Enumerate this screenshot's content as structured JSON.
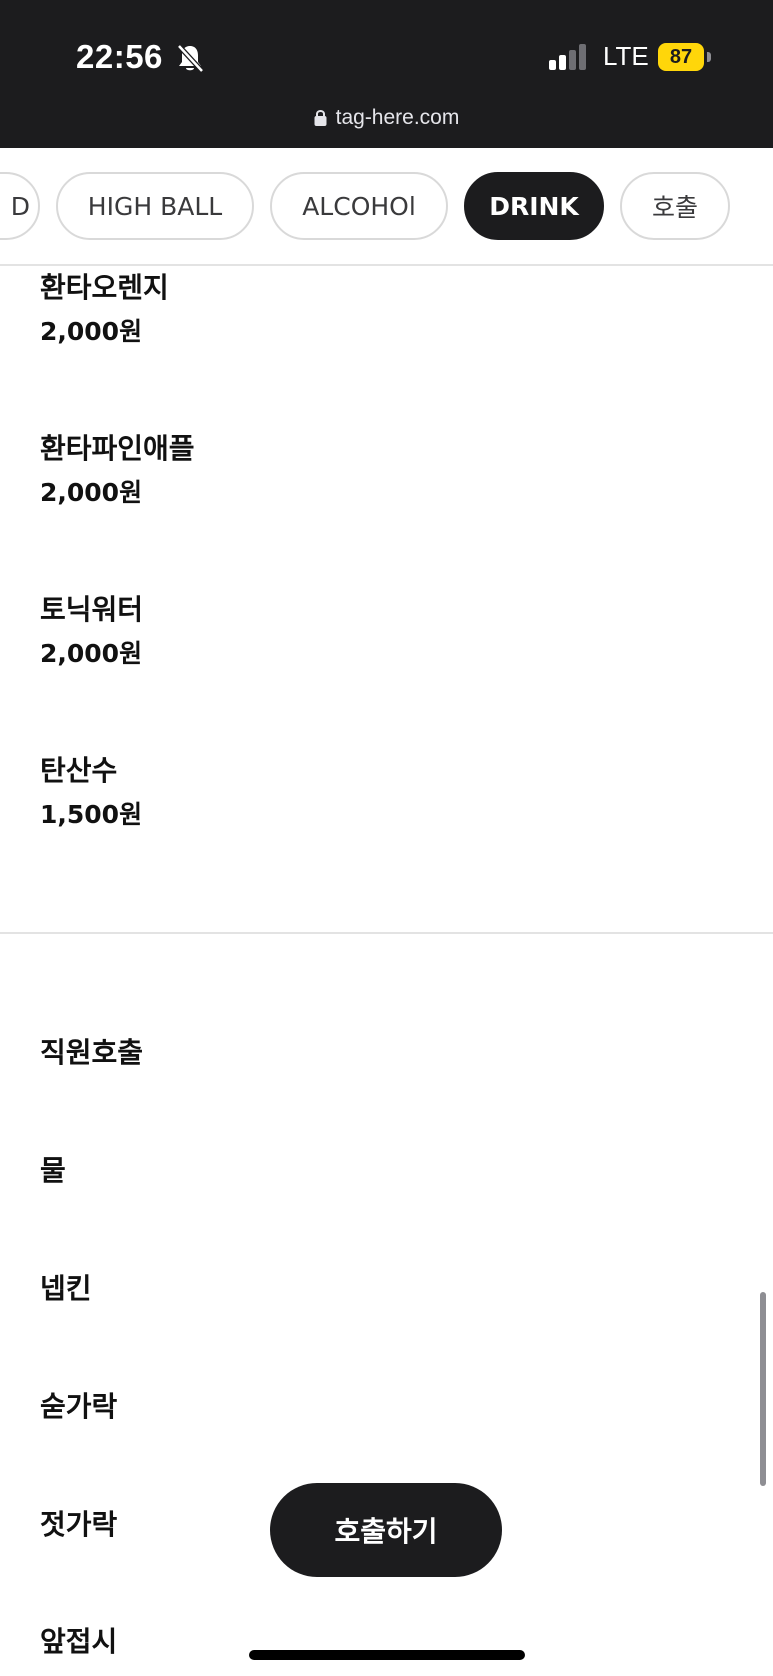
{
  "status_bar": {
    "time": "22:56",
    "network": "LTE",
    "battery": "87",
    "battery_color": "#ffd60a"
  },
  "browser": {
    "url": "tag-here.com"
  },
  "tabs": [
    {
      "label": "D",
      "active": false
    },
    {
      "label": "HIGH BALL",
      "active": false
    },
    {
      "label": "ALCOHOl",
      "active": false
    },
    {
      "label": "DRINK",
      "active": true
    },
    {
      "label": "호출",
      "active": false
    }
  ],
  "drink_items": [
    {
      "name": "환타오렌지",
      "price": "2,000원"
    },
    {
      "name": "환타파인애플",
      "price": "2,000원"
    },
    {
      "name": "토닉워터",
      "price": "2,000원"
    },
    {
      "name": "탄산수",
      "price": "1,500원"
    }
  ],
  "call_items": [
    {
      "name": "직원호출"
    },
    {
      "name": "물"
    },
    {
      "name": "넵킨"
    },
    {
      "name": "숟가락"
    },
    {
      "name": "젓가락"
    },
    {
      "name": "앞접시"
    }
  ],
  "call_button": {
    "label": "호출하기"
  },
  "colors": {
    "dark": "#1c1c1e",
    "divider": "#e3e3e3",
    "accent_battery": "#ffd60a"
  }
}
